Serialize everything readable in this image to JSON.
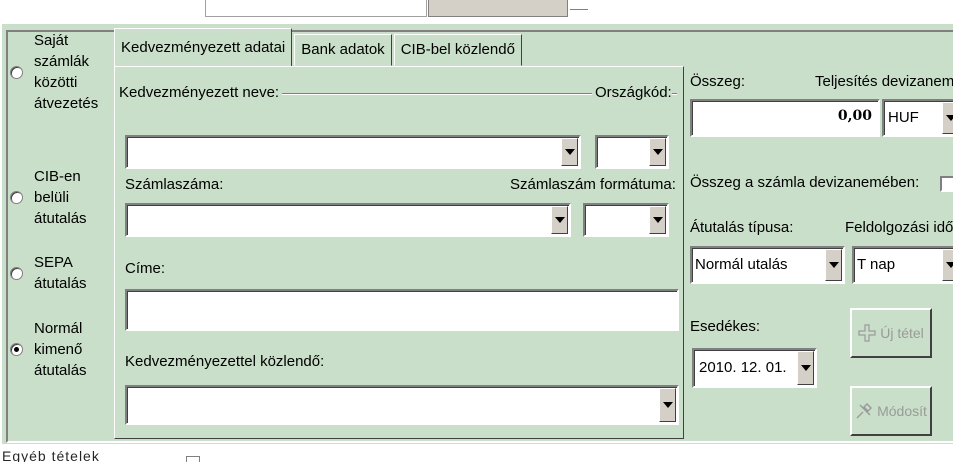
{
  "transfer_types": [
    {
      "label": "Saját\nszámlák\nközötti\nátvezetés",
      "selected": false
    },
    {
      "label": "CIB-en\nbelüli\nátutalás",
      "selected": false
    },
    {
      "label": "SEPA\nátutalás",
      "selected": false
    },
    {
      "label": "Normál\nkimenő\nátutalás",
      "selected": true
    }
  ],
  "tabs": [
    {
      "label": "Kedvezményezett adatai",
      "active": true
    },
    {
      "label": "Bank adatok",
      "active": false
    },
    {
      "label": "CIB-bel közlendő",
      "active": false
    }
  ],
  "beneficiary": {
    "name_label": "Kedvezményezett neve:",
    "name_value": "",
    "country_label": "Országkód:",
    "country_value": "",
    "account_label": "Számlaszáma:",
    "account_value": "",
    "account_format_label": "Számlaszám formátuma:",
    "account_format_value": "",
    "address_label": "Címe:",
    "address_value": "",
    "message_label": "Kedvezményezettel közlendő:",
    "message_value": ""
  },
  "amount": {
    "label": "Összeg:",
    "value": "0,00",
    "currency_label": "Teljesítés devizaneme",
    "currency_value": "HUF",
    "account_currency_label": "Összeg a számla devizanemében:"
  },
  "transfer": {
    "type_label": "Átutalás típusa:",
    "type_value": "Normál utalás",
    "processing_label": "Feldolgozási idő",
    "processing_value": "T nap",
    "due_label": "Esedékes:",
    "due_value": "2010. 12. 01."
  },
  "buttons": {
    "new_item": "Új tétel",
    "modify": "Módosít"
  },
  "bottom_text": "Egyéb tételek",
  "colors": {
    "panel_bg": "#c9dfc9",
    "field_bg": "#ffffff"
  }
}
